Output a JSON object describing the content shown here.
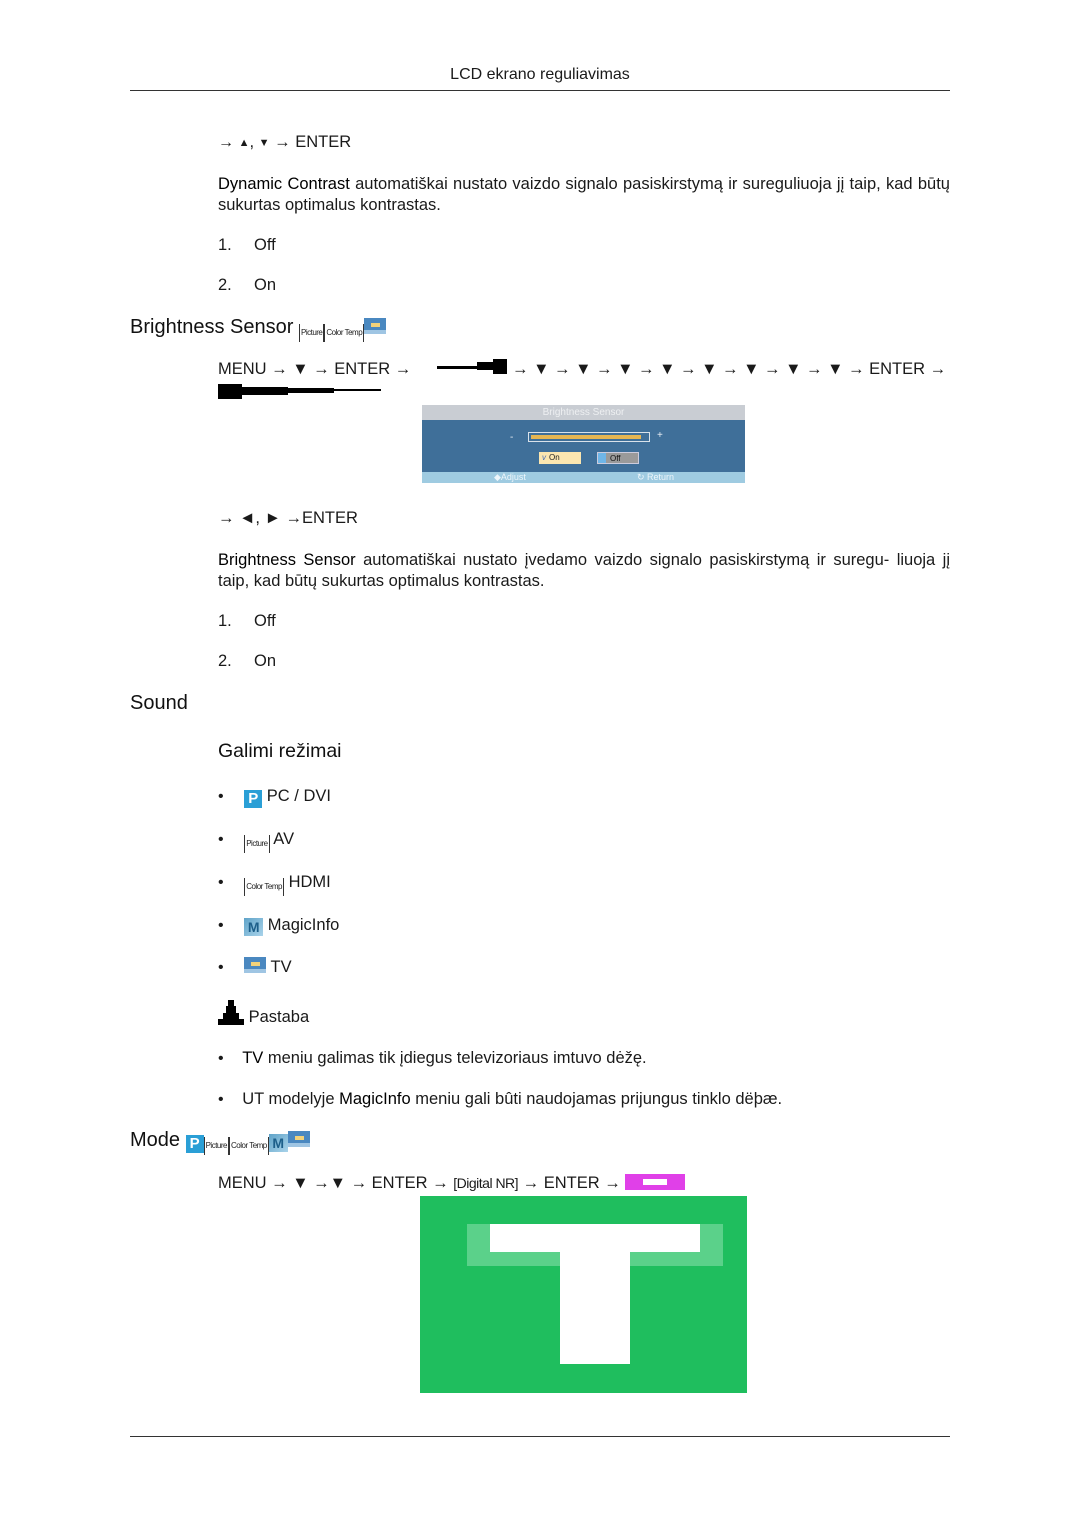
{
  "header": {
    "running_title": "LCD ekrano reguliavimas"
  },
  "dynamic_contrast": {
    "nav_prefix": "→",
    "nav_up": "▲",
    "nav_sep": ",",
    "nav_down": "▼",
    "nav_suffix": "→ ENTER",
    "term": "Dynamic Contrast",
    "description": " automatiškai nustato vaizdo signalo pasiskirstymą ir sureguliuoja jį taip, kad būtų sukurtas optimalus kontrastas.",
    "options": [
      {
        "num": "1.",
        "label": "Off"
      },
      {
        "num": "2.",
        "label": "On"
      }
    ]
  },
  "brightness_sensor": {
    "title": "Brightness Sensor",
    "icons": [
      "picture-icon",
      "color-temp-icon",
      "tv-icon"
    ],
    "icon_picture_text": "Picture",
    "icon_colortemp_text": "Color Temp",
    "menu_path_start": "MENU → ▼ → ENTER →",
    "menu_path_arrows": "→ ▼ → ▼ → ▼ → ▼ → ▼ → ▼ → ▼ → ▼ → ENTER →",
    "osd": {
      "title": "Brightness Sensor",
      "minus": "-",
      "plus": "+",
      "level_percent": 95,
      "on_label": "On",
      "on_check": "v",
      "off_label": "Off",
      "selected": "On",
      "footer_adjust": "Adjust",
      "footer_return": "Return"
    },
    "nav_line": "→ ◄, ► →ENTER",
    "term": "Brightness Sensor",
    "description": "  automatiškai nustato įvedamo vaizdo signalo pasiskirstymą ir suregu- liuoja jį taip, kad būtų sukurtas optimalus kontrastas.",
    "options": [
      {
        "num": "1.",
        "label": "Off"
      },
      {
        "num": "2.",
        "label": "On"
      }
    ]
  },
  "sound": {
    "title": "Sound",
    "subtitle": "Galimi režimai",
    "modes": [
      {
        "icon": "p-icon",
        "label": "PC / DVI"
      },
      {
        "icon": "picture-icon",
        "label": "AV"
      },
      {
        "icon": "color-temp-icon",
        "label": "HDMI"
      },
      {
        "icon": "magicinfo-icon",
        "label": "MagicInfo"
      },
      {
        "icon": "tv-icon",
        "label": "TV"
      }
    ],
    "bullet": "•",
    "p_icon_text": "P",
    "m_icon_text": "M",
    "note_title": "Pastaba",
    "notes": [
      {
        "bold": "TV",
        "text": " meniu galimas tik įdiegus televizoriaus imtuvo dėžę."
      },
      {
        "pre": "UT modelyje ",
        "bold": "MagicInfo",
        "text": " meniu gali bûti naudojamas prijungus tinklo dëþæ."
      }
    ]
  },
  "mode": {
    "title": "Mode",
    "menu_path_start": "MENU → ▼ →▼ → ENTER →",
    "digital_nr": "[Digital NR]",
    "menu_path_end": "→ ENTER →"
  }
}
